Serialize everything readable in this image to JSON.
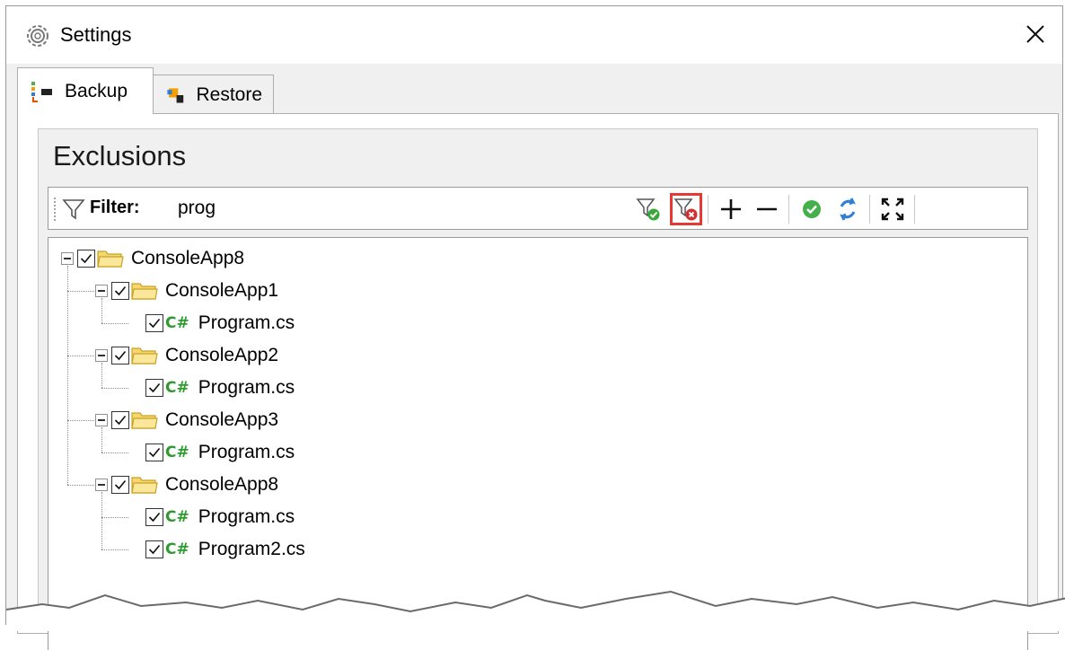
{
  "window": {
    "title": "Settings"
  },
  "tabs": [
    {
      "label": "Backup",
      "selected": true
    },
    {
      "label": "Restore",
      "selected": false
    }
  ],
  "group_title": "Exclusions",
  "toolbar": {
    "filter_label": "Filter:",
    "filter_value": "prog",
    "buttons": [
      "apply-filter-icon",
      "clear-filter-icon",
      "plus-icon",
      "minus-icon",
      "check-circle-icon",
      "refresh-icon",
      "expand-icon"
    ],
    "highlight_color": "#e53935"
  },
  "tree": {
    "root": "ConsoleApp8",
    "projects": [
      {
        "name": "ConsoleApp1",
        "files": [
          "Program.cs"
        ]
      },
      {
        "name": "ConsoleApp2",
        "files": [
          "Program.cs"
        ]
      },
      {
        "name": "ConsoleApp3",
        "files": [
          "Program.cs"
        ]
      },
      {
        "name": "ConsoleApp8",
        "files": [
          "Program.cs",
          "Program2.cs"
        ]
      }
    ],
    "file_icon_text": "C#"
  },
  "colors": {
    "cs_icon": "#2e9b2e",
    "folder": "#f5d76e",
    "check_green": "#3aa83a",
    "arrow_blue": "#2f7fd8"
  }
}
